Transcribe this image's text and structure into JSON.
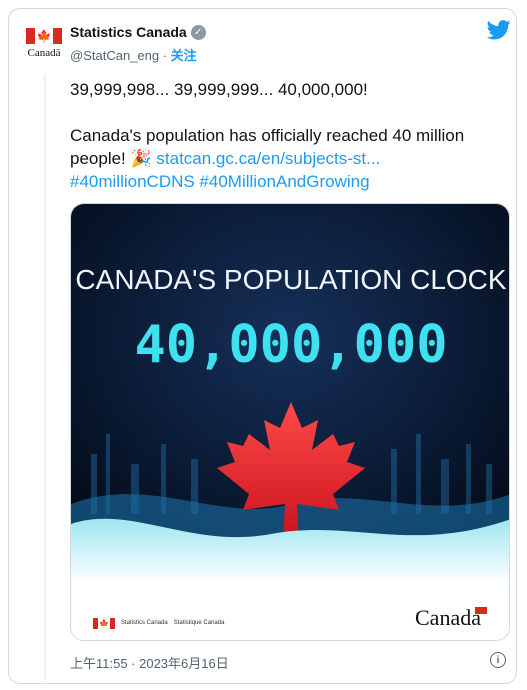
{
  "account": {
    "display_name": "Statistics Canada",
    "handle": "@StatCan_eng",
    "separator": " · ",
    "follow_label": "关注",
    "avatar_word": "Canadä"
  },
  "tweet": {
    "line1": "39,999,998... 39,999,999... 40,000,000!",
    "line2": "Canada's population has officially reached 40 million",
    "line3_text": "people! 🎉 ",
    "line3_link": "statcan.gc.ca/en/subjects-st...",
    "hashtags": "#40millionCDNS #40MillionAndGrowing"
  },
  "media": {
    "title": "CANADA'S POPULATION CLOCK",
    "counter": "40,000,000",
    "logo_en": "Statistics Canada",
    "logo_fr": "Statistique Canada",
    "wordmark": "Canada"
  },
  "footer": {
    "timestamp": "上午11:55 · 2023年6月16日"
  },
  "icons": {
    "verified": "verified-badge-icon",
    "twitter": "twitter-bird-icon",
    "info": "info-icon"
  },
  "colors": {
    "link": "#1d9bf0",
    "flag_red": "#d52b1e",
    "counter_cyan": "#3fe0f0",
    "poster_bg": "#07101f"
  }
}
